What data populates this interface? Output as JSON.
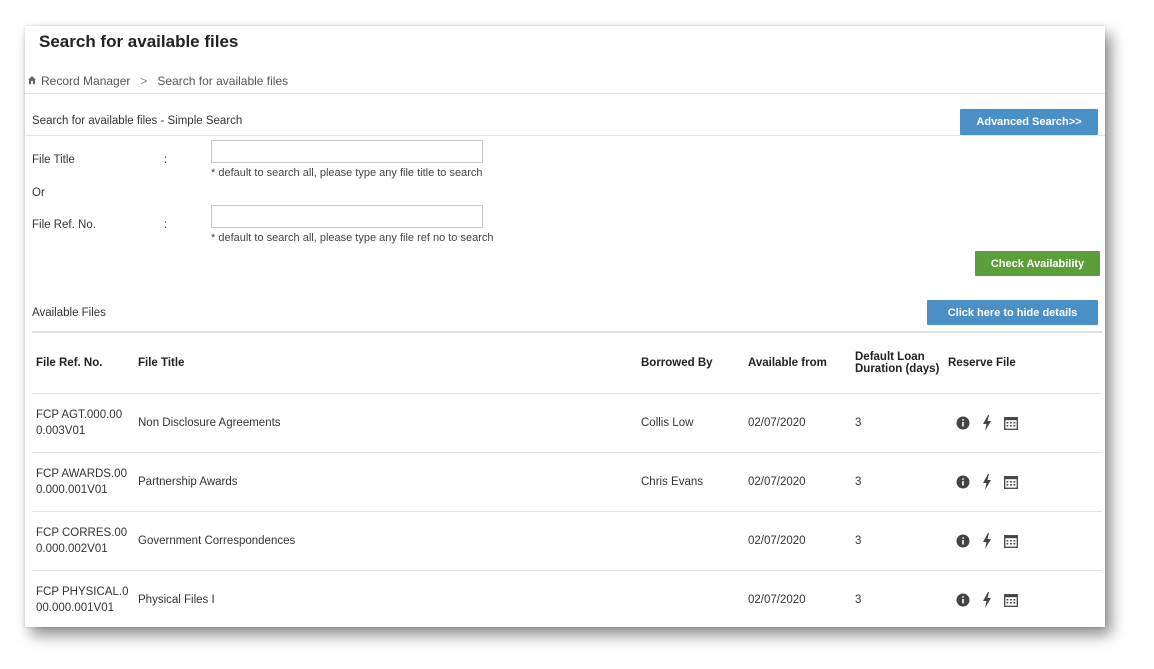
{
  "page": {
    "title": "Search for available files",
    "breadcrumb": {
      "home": "Record Manager",
      "current": "Search for available files"
    }
  },
  "search": {
    "section_title": "Search for available files - Simple Search",
    "advanced_button": "Advanced Search>>",
    "file_title_label": "File Title",
    "file_title_value": "",
    "file_title_hint": "* default to search all, please type any file title to search",
    "or_label": "Or",
    "file_ref_label": "File Ref. No.",
    "file_ref_value": "",
    "file_ref_hint": "* default to search all, please type any file ref no to search",
    "colon": ":",
    "check_button": "Check Availability"
  },
  "available": {
    "section_title": "Available Files",
    "hide_button": "Click here to hide details",
    "columns": [
      "File Ref. No.",
      "File Title",
      "Borrowed By",
      "Available from",
      "Default Loan Duration (days)",
      "Reserve File"
    ],
    "rows": [
      {
        "ref": "FCP AGT.000.000.003V01",
        "title": "Non Disclosure Agreements",
        "borrowed_by": "Collis Low",
        "available_from": "02/07/2020",
        "duration": "3"
      },
      {
        "ref": "FCP AWARDS.000.000.001V01",
        "title": "Partnership Awards",
        "borrowed_by": "Chris Evans",
        "available_from": "02/07/2020",
        "duration": "3"
      },
      {
        "ref": "FCP CORRES.000.000.002V01",
        "title": "Government Correspondences",
        "borrowed_by": "",
        "available_from": "02/07/2020",
        "duration": "3"
      },
      {
        "ref": "FCP PHYSICAL.000.000.001V01",
        "title": "Physical Files I",
        "borrowed_by": "",
        "available_from": "02/07/2020",
        "duration": "3"
      }
    ],
    "row_icons": [
      "info-icon",
      "lightning-icon",
      "calendar-icon"
    ]
  },
  "colors": {
    "blue_button": "#4a90c7",
    "green_button": "#5b9e3a"
  }
}
